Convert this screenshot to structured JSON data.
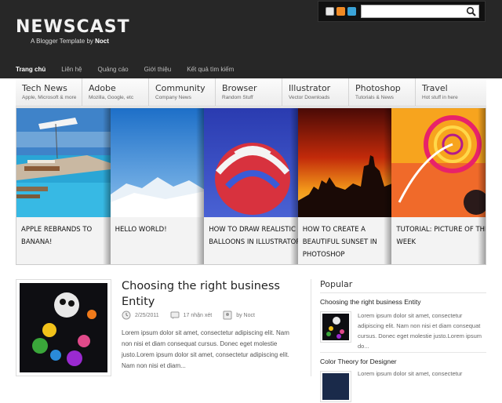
{
  "header": {
    "logo": "NEWSCAST",
    "tagline_prefix": "A Blogger Template by ",
    "tagline_author": "Noct",
    "search_placeholder": "",
    "social_icons": [
      "mail-icon",
      "rss-icon",
      "twitter-icon"
    ]
  },
  "topnav": [
    {
      "label": "Trang chủ",
      "active": true
    },
    {
      "label": "Liên hệ"
    },
    {
      "label": "Quảng cáo"
    },
    {
      "label": "Giới thiệu"
    },
    {
      "label": "Kết quả tìm kiếm"
    }
  ],
  "categories": [
    {
      "title": "Tech News",
      "sub": "Apple, Microsoft & more"
    },
    {
      "title": "Adobe",
      "sub": "Mozilla, Google, etc"
    },
    {
      "title": "Community",
      "sub": "Company News"
    },
    {
      "title": "Browser",
      "sub": "Random Stuff"
    },
    {
      "title": "Illustrator",
      "sub": "Vector Downloads"
    },
    {
      "title": "Photoshop",
      "sub": "Tutorials & News"
    },
    {
      "title": "Travel",
      "sub": "Hot stuff in here"
    }
  ],
  "slides": [
    {
      "caption": [
        "APPLE REBRANDS TO",
        "BANANA!"
      ]
    },
    {
      "caption": [
        "HELLO WORLD!"
      ]
    },
    {
      "caption": [
        "HOW TO DRAW REALISTIC",
        "BALLOONS IN ILLUSTRATOR"
      ]
    },
    {
      "caption": [
        "HOW TO CREATE A",
        "BEAUTIFUL SUNSET IN",
        "PHOTOSHOP"
      ]
    },
    {
      "caption": [
        "TUTORIAL: PICTURE OF THE",
        "WEEK"
      ]
    }
  ],
  "post": {
    "title": "Choosing the right business Entity",
    "date": "2/25/2011",
    "comments": "17 nhận xét",
    "author": "by Noct",
    "excerpt": "Lorem ipsum dolor sit amet, consectetur adipiscing elit. Nam non nisi et diam consequat cursus. Donec eget molestie justo.Lorem ipsum dolor sit amet, consectetur adipiscing elit. Nam non nisi et diam..."
  },
  "popular": {
    "heading": "Popular",
    "items": [
      {
        "title": "Choosing the right business Entity",
        "text": "Lorem ipsum dolor sit amet, consectetur adipiscing elit. Nam non nisi et diam consequat cursus. Donec eget molestie justo.Lorem ipsum do..."
      },
      {
        "title": "Color Theory for Designer",
        "text": "Lorem ipsum dolor sit amet, consectetur"
      }
    ]
  },
  "colors": {
    "header_bg": "#272727",
    "page_bg": "#ffffff",
    "accent_text": "#222222"
  }
}
